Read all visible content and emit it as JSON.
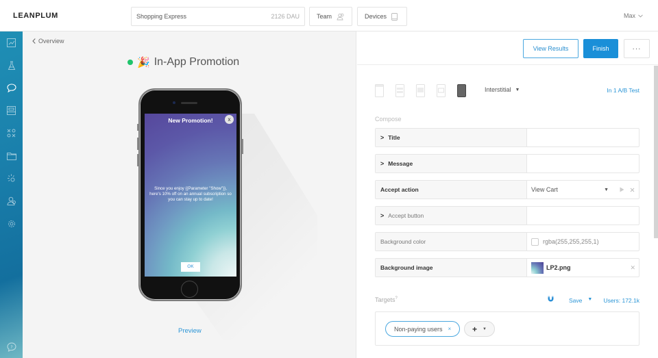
{
  "header": {
    "logo": "LEANPLUM",
    "app_selector": {
      "name": "Shopping Express",
      "dau": "2126 DAU"
    },
    "team_button": {
      "label": "Team",
      "icon": "team-icon"
    },
    "devices_button": {
      "label": "Devices",
      "icon": "device-icon"
    },
    "user_menu": {
      "label": "Max",
      "icon": "chevron-down-icon"
    }
  },
  "sidebar": {
    "items": [
      {
        "name": "analytics",
        "icon": "chart-icon"
      },
      {
        "name": "ab-tests",
        "icon": "flask-icon"
      },
      {
        "name": "messaging",
        "icon": "chat-bubble-icon",
        "active": true
      },
      {
        "name": "content",
        "icon": "inbox-icon"
      },
      {
        "name": "variables",
        "icon": "xo-icon"
      },
      {
        "name": "files",
        "icon": "folder-icon"
      },
      {
        "name": "events",
        "icon": "sparkle-icon"
      },
      {
        "name": "users",
        "icon": "users-icon"
      },
      {
        "name": "settings",
        "icon": "gear-icon"
      }
    ],
    "help": {
      "icon": "help-bubble-icon"
    }
  },
  "preview": {
    "back_link": "Overview",
    "message_title": "In-App Promotion",
    "status_color": "#1fc46b",
    "emoji": "🎉",
    "phone_screen": {
      "title": "New Promotion!",
      "close": "x",
      "message": "Since you enjoy {{Parameter \"Show\"}}, here's 10% off on an annual subscription so you can stay up to date!",
      "ok_button": "OK"
    },
    "preview_link": "Preview"
  },
  "actions": {
    "view_results": "View Results",
    "finish": "Finish",
    "more": "···"
  },
  "compose": {
    "template_icons": [
      "banner-top-icon",
      "center-popup-icon",
      "alert-icon",
      "list-icon",
      "interstitial-icon"
    ],
    "template_select": "Interstitial",
    "ab_test_link": "In 1 A/B Test",
    "section_label": "Compose",
    "fields": [
      {
        "label": "Title",
        "expandable": true,
        "value": ""
      },
      {
        "label": "Message",
        "expandable": true,
        "value": ""
      },
      {
        "label": "Accept action",
        "value": "View Cart"
      },
      {
        "label": "Accept button",
        "expandable": true,
        "value": ""
      },
      {
        "label": "Background color",
        "value": "rgba(255,255,255,1)"
      },
      {
        "label": "Background image",
        "value": "LP2.png"
      }
    ]
  },
  "targets": {
    "label": "Targets",
    "help": "?",
    "save": "Save",
    "users": "Users: 172.1k",
    "segments": [
      {
        "label": "Non-paying users",
        "remove": "×"
      }
    ],
    "add": "+"
  },
  "colors": {
    "accent": "#1a8fd8",
    "sidebar_top": "#1f8fb5",
    "sidebar_bottom": "#6fb8c4"
  }
}
